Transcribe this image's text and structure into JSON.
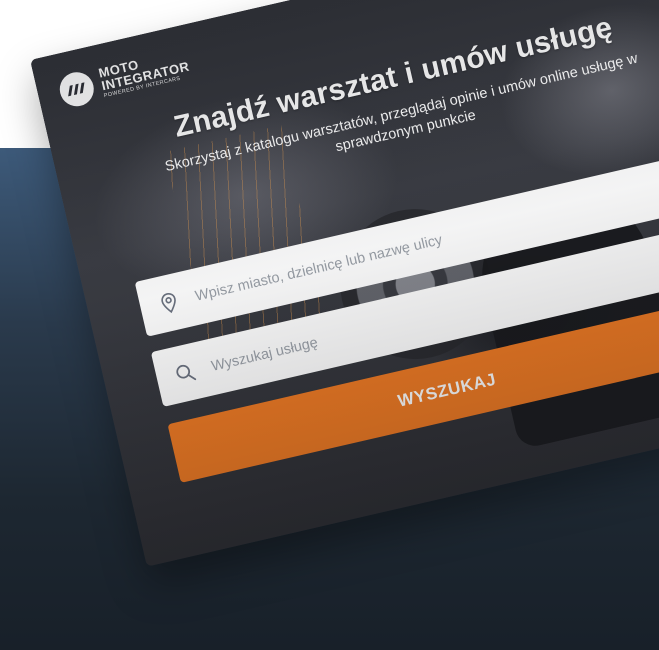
{
  "brand": {
    "line1": "MOTO",
    "line2": "INTEGRATOR",
    "line3": "POWERED BY INTERCARS",
    "accent": "#f07a22"
  },
  "header": {
    "menu_icon": "hamburger-menu-icon"
  },
  "hero": {
    "title": "Znajdź warsztat i umów usługę",
    "subtitle": "Skorzystaj z katalogu warsztatów, przeglądaj opinie i umów online usługę w sprawdzonym punkcie"
  },
  "search": {
    "location_placeholder": "Wpisz miasto, dzielnicę lub nazwę ulicy",
    "location_icon": "map-pin-icon",
    "service_placeholder": "Wyszukaj usługę",
    "service_icon": "search-icon",
    "button_label": "WYSZUKAJ"
  }
}
